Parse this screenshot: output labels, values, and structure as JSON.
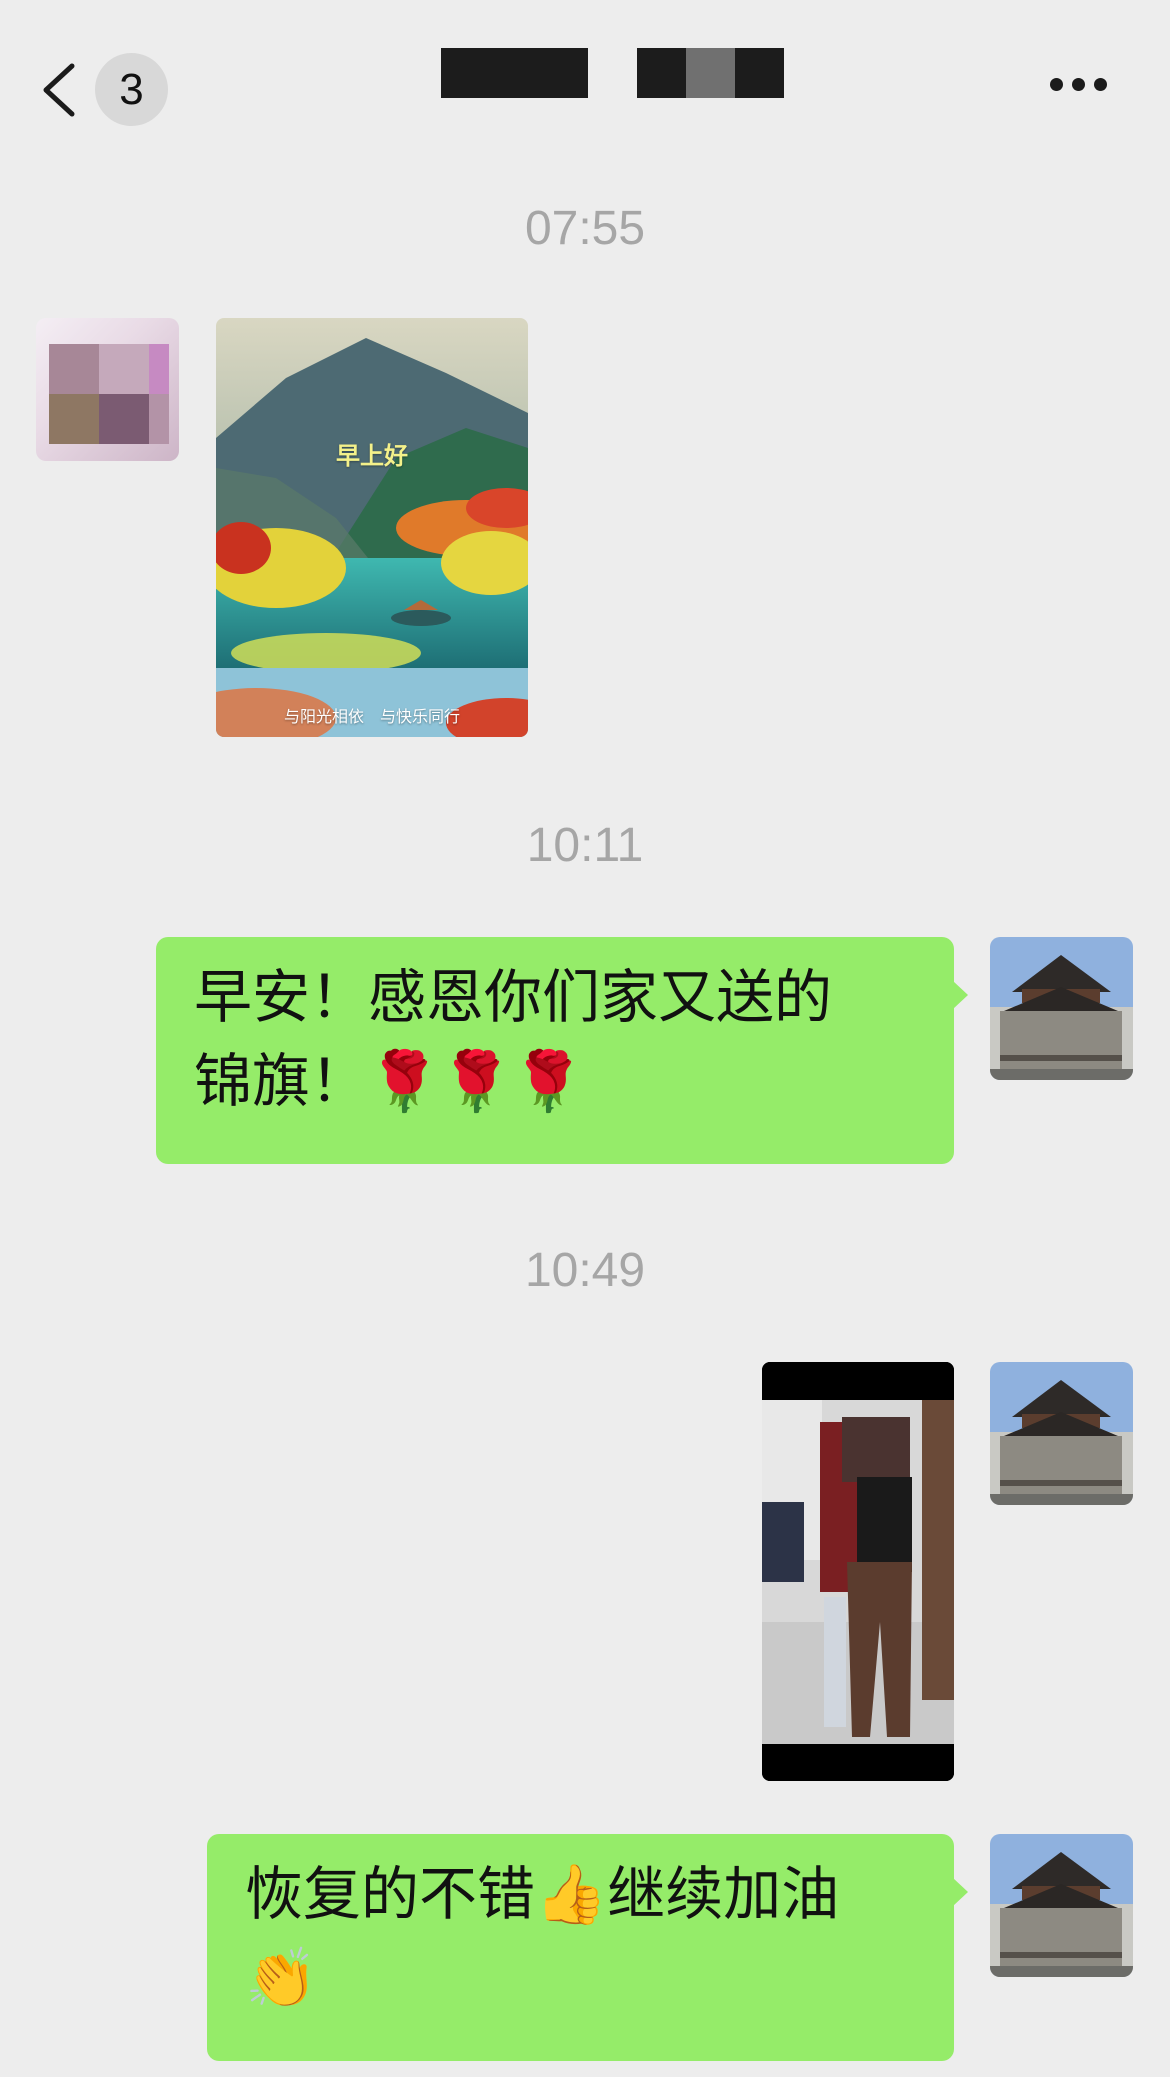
{
  "header": {
    "unread_count": "3",
    "back_icon": "chevron-left-icon",
    "more_icon": "ellipsis-icon"
  },
  "messages": [
    {
      "time": "07:55",
      "side": "left",
      "type": "image",
      "image": {
        "title_text": "早上好",
        "footer_text": "与阳光相依　与快乐同行"
      }
    },
    {
      "time": "10:11",
      "side": "right",
      "type": "text",
      "lines": [
        "早安！感恩你们家又送的",
        "锦旗！🌹🌹🌹"
      ]
    },
    {
      "time": "10:49",
      "side": "right",
      "type": "video"
    },
    {
      "side": "right",
      "type": "text",
      "lines": [
        "恢复的不错👍继续加油",
        "👏"
      ]
    }
  ],
  "colors": {
    "background": "#ededed",
    "sent_bubble": "#95ec69",
    "timestamp": "#a6a6a6"
  }
}
